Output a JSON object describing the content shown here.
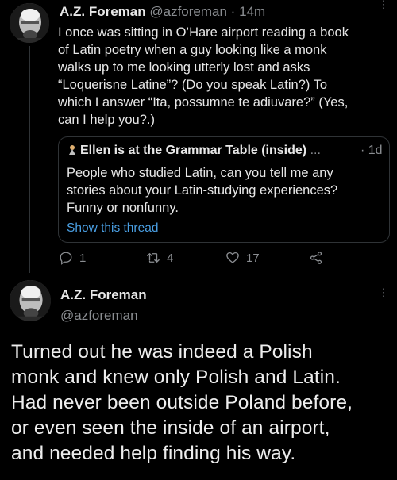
{
  "tweet": {
    "author_name": "A.Z. Foreman",
    "author_handle": "@azforeman",
    "separator": "·",
    "time": "14m",
    "text_lines": [
      "I once was sitting in O’Hare airport reading a book",
      "of Latin poetry when a guy looking like a monk",
      "walks up to me looking utterly lost and asks",
      "“Loquerisne Latine”? (Do you speak Latin?) To",
      "which I answer “Ita, possumne te adiuvare?” (Yes,",
      "can I help you?.)"
    ],
    "quoted": {
      "author_name": "Ellen is at the Grammar Table (inside)",
      "ellipsis": "...",
      "separator": "·",
      "time": "1d",
      "text_lines": [
        "People who studied Latin, can you tell me any",
        "stories about your Latin-studying experiences?",
        "Funny or nonfunny."
      ],
      "show_thread": "Show this thread"
    },
    "actions": {
      "reply_count": "1",
      "retweet_count": "4",
      "like_count": "17"
    }
  },
  "reply": {
    "author_name": "A.Z. Foreman",
    "author_handle": "@azforeman",
    "text_lines": [
      "Turned out he was indeed a Polish",
      "monk and knew only Polish and Latin.",
      "Had never been outside Poland before,",
      "or even seen the inside of an airport,",
      "and needed help finding his way."
    ]
  },
  "colors": {
    "background": "#000000",
    "link": "#4a9fe3",
    "muted": "#8a8d91"
  }
}
